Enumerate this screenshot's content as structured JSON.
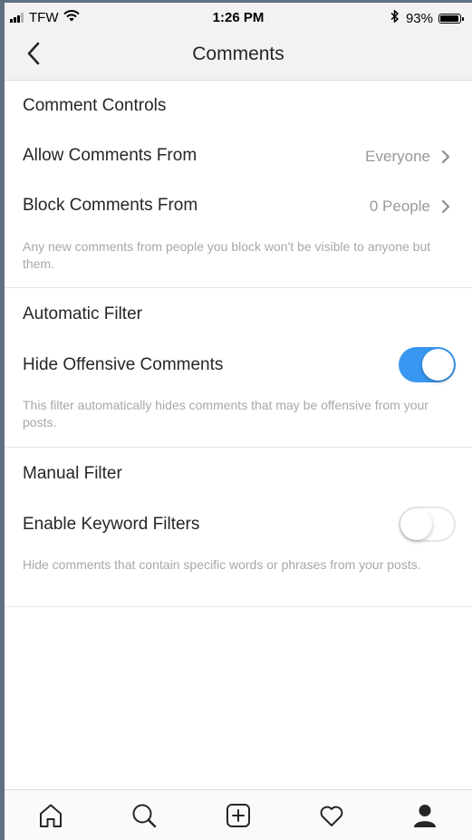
{
  "status_bar": {
    "carrier": "TFW",
    "time": "1:26 PM",
    "battery": "93%"
  },
  "header": {
    "title": "Comments"
  },
  "sections": {
    "comment_controls": {
      "title": "Comment Controls",
      "allow": {
        "label": "Allow Comments From",
        "value": "Everyone"
      },
      "block": {
        "label": "Block Comments From",
        "value": "0 People"
      },
      "note": "Any new comments from people you block won't be visible to anyone but them."
    },
    "automatic_filter": {
      "title": "Automatic Filter",
      "hide": {
        "label": "Hide Offensive Comments",
        "enabled": true
      },
      "note": "This filter automatically hides comments that may be offensive from your posts."
    },
    "manual_filter": {
      "title": "Manual Filter",
      "keyword": {
        "label": "Enable Keyword Filters",
        "enabled": false
      },
      "note": "Hide comments that contain specific words or phrases from your posts."
    }
  },
  "tabbar": {
    "icons": [
      "home-icon",
      "search-icon",
      "add-post-icon",
      "heart-icon",
      "profile-icon"
    ]
  },
  "colors": {
    "accent": "#3897f0",
    "text": "#262626",
    "muted": "#a8a8a8"
  }
}
